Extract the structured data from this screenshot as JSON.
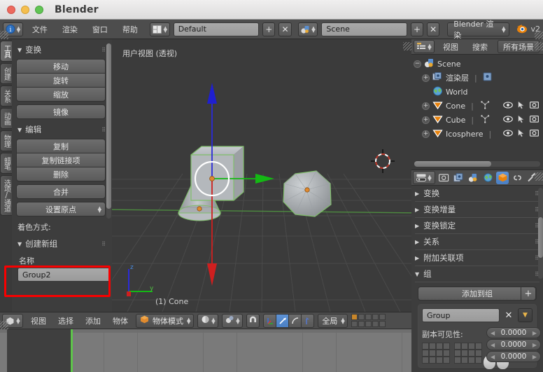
{
  "window": {
    "app_title": "Blender",
    "traffic_lights": [
      "close-red",
      "minimize-yellow",
      "maximize-green"
    ]
  },
  "top_header": {
    "info_editor_icon": "info-editor-icon",
    "menus": [
      "文件",
      "渲染",
      "窗口",
      "帮助"
    ],
    "screen_layout_icon": "screen-layout-icon",
    "screen_layout_value": "Default",
    "screen_add_label": "+",
    "screen_delete_label": "✕",
    "scene_icon": "scene-icon",
    "scene_value": "Scene",
    "scene_add_label": "+",
    "scene_delete_label": "✕",
    "render_engine_value": "Blender 渲染",
    "blender_logo_icon": "blender-logo-icon",
    "version_text": "v2"
  },
  "tool_shelf": {
    "vertical_tabs": [
      {
        "label": "工具",
        "active": true
      },
      {
        "label": "创建",
        "active": false
      },
      {
        "label": "关系",
        "active": false
      },
      {
        "label": "动画",
        "active": false
      },
      {
        "label": "物理",
        "active": false
      },
      {
        "label": "蜡笔",
        "active": false
      },
      {
        "label": "选项/通道",
        "active": false
      }
    ],
    "transform_panel": {
      "title": "变换",
      "buttons": [
        "移动",
        "旋转",
        "缩放",
        "镜像"
      ]
    },
    "edit_panel": {
      "title": "编辑",
      "buttons": [
        "复制",
        "复制链接项",
        "删除",
        "合并"
      ],
      "set_origin_label": "设置原点",
      "shading_label": "着色方式:"
    },
    "create_group_panel": {
      "title": "创建新组",
      "name_label": "名称",
      "name_value": "Group2",
      "highlight_color": "#f90000"
    }
  },
  "viewport": {
    "view_label": "用户视图 (透视)",
    "active_object_label": "(1) Cone",
    "axis_gizmo": {
      "z": "z",
      "y": "y"
    },
    "objects": [
      "Cone",
      "Cube",
      "Icosphere"
    ]
  },
  "viewport_footer": {
    "editor_icon": "3d-view-editor-icon",
    "menus": [
      "视图",
      "选择",
      "添加",
      "物体"
    ],
    "mode_icon": "object-mode-icon",
    "mode_value": "物体模式",
    "viewport_shading_icon": "solid-shading-icon",
    "pivot_icon": "pivot-point-icon",
    "snap_icon": "snap-magnet-icon",
    "manipulators": [
      {
        "name": "translate-manipulator-icon",
        "active": false
      },
      {
        "name": "rotate-manipulator-icon",
        "active": true
      },
      {
        "name": "scale-manipulator-icon",
        "active": false
      },
      {
        "name": "manipulator-handle-icon",
        "active": false
      }
    ],
    "orientation_value": "全局"
  },
  "outliner": {
    "editor_icon": "outliner-editor-icon",
    "menus": [
      "视图",
      "搜索"
    ],
    "display_mode": "所有场景",
    "rows": [
      {
        "label": "Scene",
        "icon": "scene-icon",
        "indent": 0,
        "expander": "−",
        "eye": false,
        "cursor": false,
        "camera": false
      },
      {
        "label": "渲染层",
        "icon": "renderlayer-icon",
        "indent": 1,
        "expander": "+",
        "eye": false,
        "cursor": false,
        "camera": false
      },
      {
        "label": "World",
        "icon": "world-icon",
        "indent": 1,
        "expander": "",
        "eye": false,
        "cursor": false,
        "camera": false
      },
      {
        "label": "Cone",
        "icon": "mesh-object-icon",
        "indent": 1,
        "expander": "+",
        "eye": true,
        "cursor": true,
        "camera": true
      },
      {
        "label": "Cube",
        "icon": "mesh-object-icon",
        "indent": 1,
        "expander": "+",
        "eye": true,
        "cursor": true,
        "camera": true
      },
      {
        "label": "Icosphere",
        "icon": "mesh-object-icon",
        "indent": 1,
        "expander": "+",
        "eye": true,
        "cursor": true,
        "camera": true
      }
    ]
  },
  "properties": {
    "editor_icon": "properties-editor-icon",
    "tabs": [
      {
        "name": "render-tab-icon",
        "selected": false
      },
      {
        "name": "render-layers-tab-icon",
        "selected": false
      },
      {
        "name": "scene-tab-icon",
        "selected": false
      },
      {
        "name": "world-tab-icon",
        "selected": false
      },
      {
        "name": "object-tab-icon",
        "selected": true
      },
      {
        "name": "constraints-tab-icon",
        "selected": false
      },
      {
        "name": "modifiers-tab-icon",
        "selected": false
      }
    ],
    "sections": [
      {
        "label": "变换",
        "open": false
      },
      {
        "label": "变换增量",
        "open": false
      },
      {
        "label": "变换锁定",
        "open": false
      },
      {
        "label": "关系",
        "open": false
      },
      {
        "label": "附加关联项",
        "open": false
      },
      {
        "label": "组",
        "open": true
      }
    ],
    "groups": {
      "add_to_group_label": "添加到组",
      "add_icon": "plus-icon",
      "group_name": "Group",
      "remove_icon": "x-icon",
      "dropdown_icon": "chevron-down-icon",
      "dupli_visibility_label": "副本可见性:",
      "values": [
        "0.0000",
        "0.0000",
        "0.0000"
      ]
    }
  }
}
